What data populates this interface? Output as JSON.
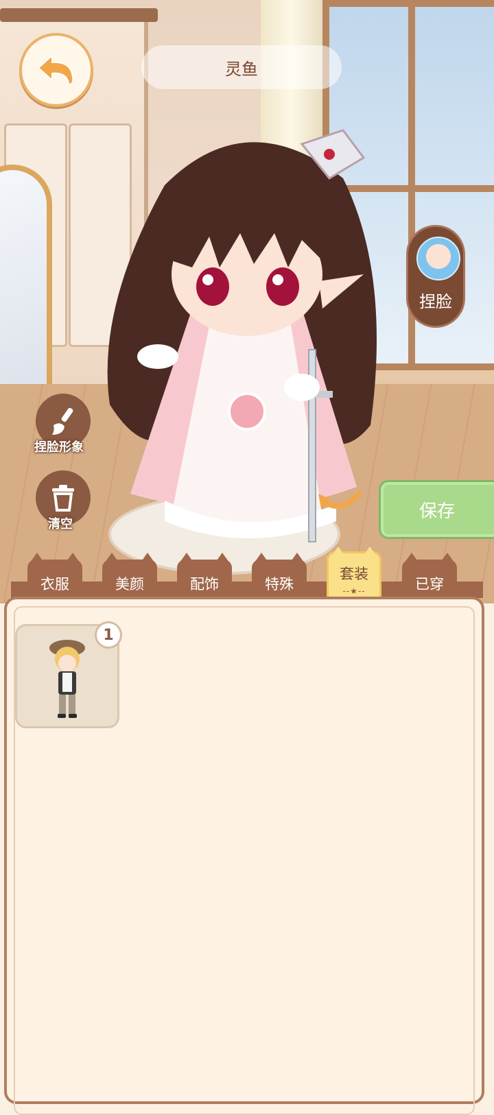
{
  "header": {
    "character_name": "灵鱼",
    "back_icon": "back-arrow-icon"
  },
  "side_buttons": {
    "face_edit_label": "捏脸",
    "face_image_label": "捏脸形象",
    "clear_label": "清空"
  },
  "save_label": "保存",
  "tabs": [
    {
      "label": "衣服",
      "active": false
    },
    {
      "label": "美颜",
      "active": false
    },
    {
      "label": "配饰",
      "active": false
    },
    {
      "label": "特殊",
      "active": false
    },
    {
      "label": "套装",
      "active": true
    },
    {
      "label": "已穿",
      "active": false
    }
  ],
  "outfits": [
    {
      "count": "1"
    }
  ],
  "colors": {
    "accent_orange": "#f2a64a",
    "tab_brown": "#a0674a",
    "save_green": "#a9d98a",
    "active_tab_yellow": "#fbe08a"
  }
}
